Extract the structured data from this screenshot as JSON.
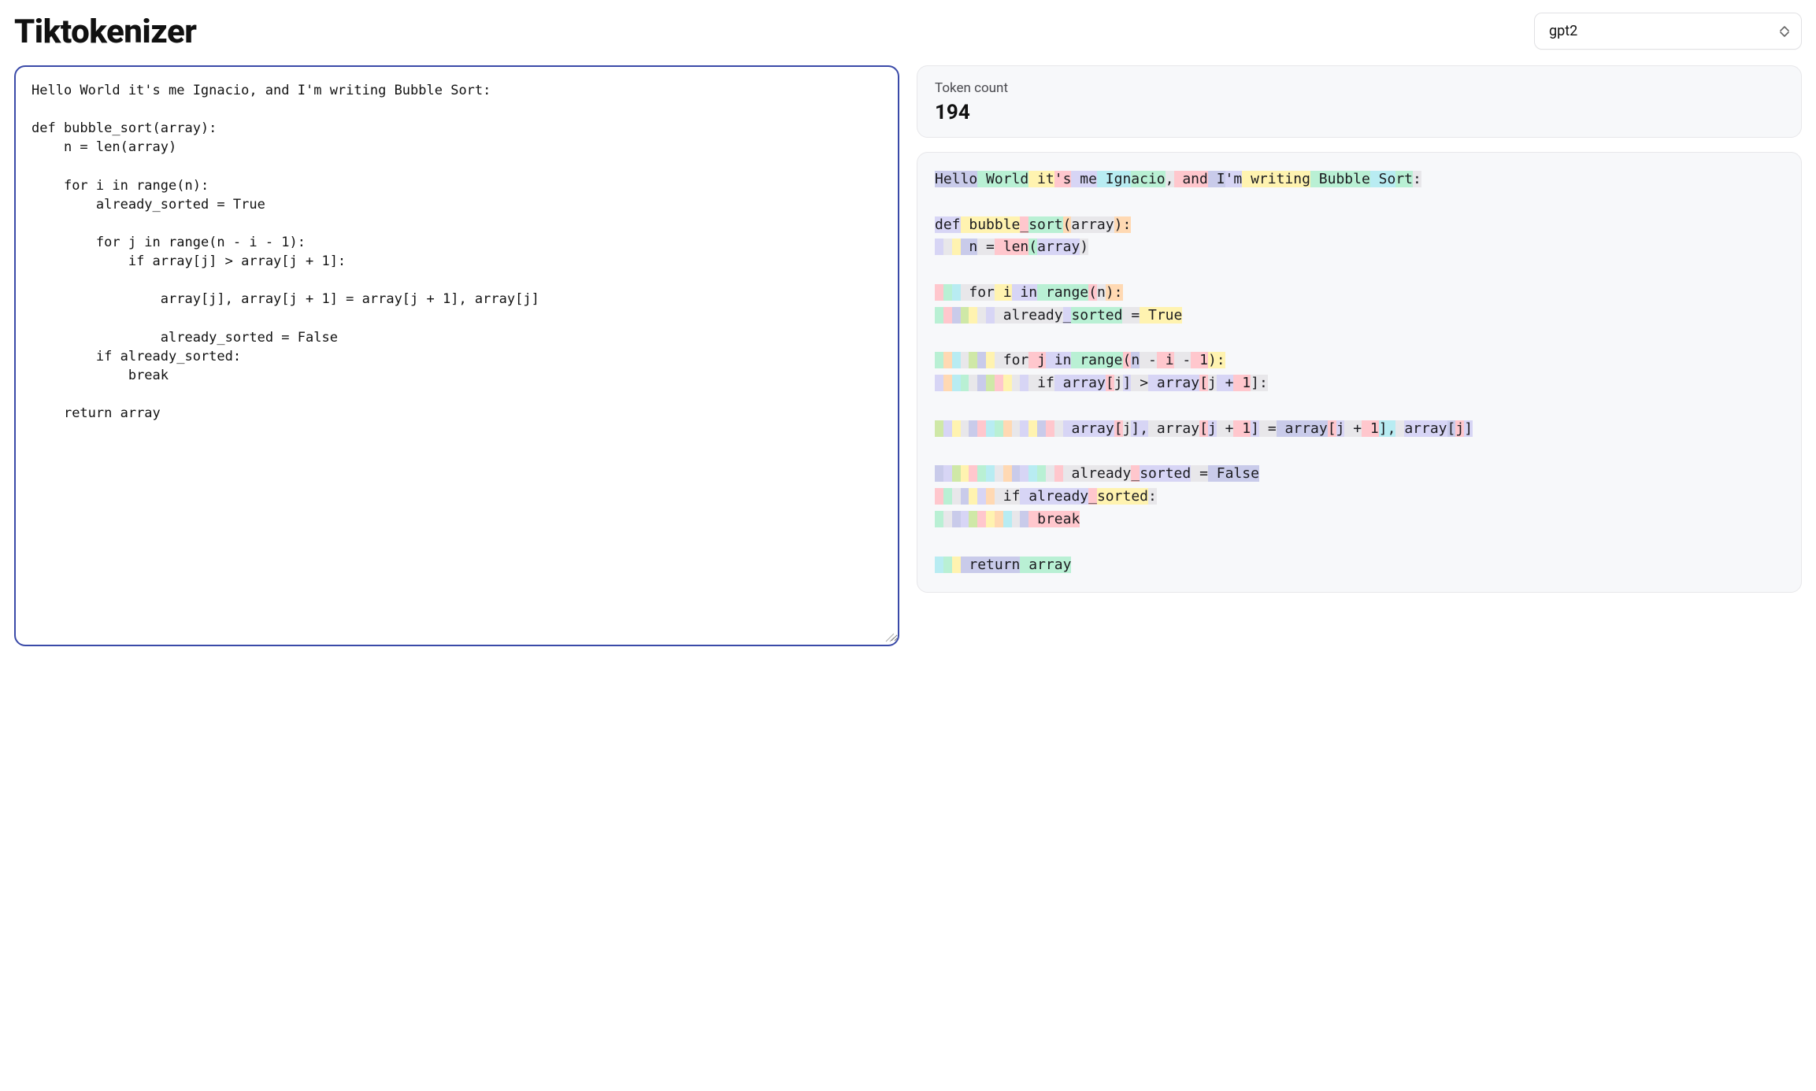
{
  "header": {
    "title": "Tiktokenizer",
    "model_select": {
      "value": "gpt2"
    }
  },
  "input": {
    "text": "Hello World it's me Ignacio, and I'm writing Bubble Sort:\n\ndef bubble_sort(array):\n    n = len(array)\n\n    for i in range(n):\n        already_sorted = True\n\n        for j in range(n - i - 1):\n            if array[j] > array[j + 1]:\n\n                array[j], array[j + 1] = array[j + 1], array[j]\n\n                already_sorted = False\n        if already_sorted:\n            break\n\n    return array"
  },
  "token_count": {
    "label": "Token count",
    "value": "194"
  },
  "palette": [
    "#c9cbea",
    "#b9f0d4",
    "#fff3b0",
    "#ffc7cd",
    "#d7d5f5",
    "#b8ecf2",
    "#f4d2ec",
    "#cfe8a7",
    "#e8e7ea",
    "#ffd9b3"
  ],
  "tokens": [
    {
      "t": "Hello",
      "c": 0
    },
    {
      "t": " World",
      "c": 1
    },
    {
      "t": " it",
      "c": 2
    },
    {
      "t": "'s",
      "c": 3
    },
    {
      "t": " me",
      "c": 4
    },
    {
      "t": " Ign",
      "c": 5
    },
    {
      "t": "acio",
      "c": 1
    },
    {
      "t": ",",
      "c": 8
    },
    {
      "t": " and",
      "c": 3
    },
    {
      "t": " I",
      "c": 0
    },
    {
      "t": "'m",
      "c": 4
    },
    {
      "t": " writing",
      "c": 2
    },
    {
      "t": " Bubble",
      "c": 1
    },
    {
      "t": " So",
      "c": 5
    },
    {
      "t": "rt",
      "c": 1
    },
    {
      "t": ":",
      "c": 8
    },
    {
      "t": "\n",
      "c": -1
    },
    {
      "t": "\n",
      "c": -1
    },
    {
      "t": "def",
      "c": 4
    },
    {
      "t": " bubble",
      "c": 2
    },
    {
      "t": "_",
      "c": 3
    },
    {
      "t": "sort",
      "c": 1
    },
    {
      "t": "(",
      "c": 9
    },
    {
      "t": "array",
      "c": 8
    },
    {
      "t": "):",
      "c": 9
    },
    {
      "t": "\n",
      "c": -1
    },
    {
      "t": " ",
      "c": 4
    },
    {
      "t": " ",
      "c": 8
    },
    {
      "t": " ",
      "c": 2
    },
    {
      "t": " n",
      "c": 0
    },
    {
      "t": " =",
      "c": 8
    },
    {
      "t": " len",
      "c": 3
    },
    {
      "t": "(",
      "c": 1
    },
    {
      "t": "array",
      "c": 4
    },
    {
      "t": ")",
      "c": 8
    },
    {
      "t": "\n",
      "c": -1
    },
    {
      "t": "\n",
      "c": -1
    },
    {
      "t": " ",
      "c": 3
    },
    {
      "t": " ",
      "c": 1
    },
    {
      "t": " ",
      "c": 5
    },
    {
      "t": " for",
      "c": 8
    },
    {
      "t": " i",
      "c": 2
    },
    {
      "t": " in",
      "c": 4
    },
    {
      "t": " range",
      "c": 1
    },
    {
      "t": "(",
      "c": 3
    },
    {
      "t": "n",
      "c": 8
    },
    {
      "t": "):",
      "c": 9
    },
    {
      "t": "\n",
      "c": -1
    },
    {
      "t": " ",
      "c": 1
    },
    {
      "t": " ",
      "c": 3
    },
    {
      "t": " ",
      "c": 0
    },
    {
      "t": " ",
      "c": 7
    },
    {
      "t": " ",
      "c": 2
    },
    {
      "t": " ",
      "c": 8
    },
    {
      "t": " ",
      "c": 4
    },
    {
      "t": " already",
      "c": 8
    },
    {
      "t": "_",
      "c": 4
    },
    {
      "t": "sorted",
      "c": 1
    },
    {
      "t": " =",
      "c": 8
    },
    {
      "t": " True",
      "c": 2
    },
    {
      "t": "\n",
      "c": -1
    },
    {
      "t": "\n",
      "c": -1
    },
    {
      "t": " ",
      "c": 1
    },
    {
      "t": " ",
      "c": 9
    },
    {
      "t": " ",
      "c": 5
    },
    {
      "t": " ",
      "c": 8
    },
    {
      "t": " ",
      "c": 7
    },
    {
      "t": " ",
      "c": 0
    },
    {
      "t": " ",
      "c": 2
    },
    {
      "t": " for",
      "c": 8
    },
    {
      "t": " j",
      "c": 3
    },
    {
      "t": " in",
      "c": 4
    },
    {
      "t": " range",
      "c": 1
    },
    {
      "t": "(",
      "c": 3
    },
    {
      "t": "n",
      "c": 0
    },
    {
      "t": " -",
      "c": 8
    },
    {
      "t": " i",
      "c": 3
    },
    {
      "t": " -",
      "c": 8
    },
    {
      "t": " 1",
      "c": 3
    },
    {
      "t": "):",
      "c": 2
    },
    {
      "t": "\n",
      "c": -1
    },
    {
      "t": " ",
      "c": 4
    },
    {
      "t": " ",
      "c": 9
    },
    {
      "t": " ",
      "c": 5
    },
    {
      "t": " ",
      "c": 1
    },
    {
      "t": " ",
      "c": 8
    },
    {
      "t": " ",
      "c": 0
    },
    {
      "t": " ",
      "c": 7
    },
    {
      "t": " ",
      "c": 3
    },
    {
      "t": " ",
      "c": 2
    },
    {
      "t": " ",
      "c": 8
    },
    {
      "t": " ",
      "c": 4
    },
    {
      "t": " if",
      "c": 8
    },
    {
      "t": " array",
      "c": 4
    },
    {
      "t": "[",
      "c": 3
    },
    {
      "t": "j",
      "c": 8
    },
    {
      "t": "]",
      "c": 4
    },
    {
      "t": " >",
      "c": 8
    },
    {
      "t": " array",
      "c": 4
    },
    {
      "t": "[",
      "c": 3
    },
    {
      "t": "j",
      "c": 8
    },
    {
      "t": " +",
      "c": 4
    },
    {
      "t": " 1",
      "c": 3
    },
    {
      "t": "]:",
      "c": 8
    },
    {
      "t": "\n",
      "c": -1
    },
    {
      "t": "\n",
      "c": -1
    },
    {
      "t": " ",
      "c": 7
    },
    {
      "t": " ",
      "c": 4
    },
    {
      "t": " ",
      "c": 2
    },
    {
      "t": " ",
      "c": 8
    },
    {
      "t": " ",
      "c": 0
    },
    {
      "t": " ",
      "c": 3
    },
    {
      "t": " ",
      "c": 5
    },
    {
      "t": " ",
      "c": 1
    },
    {
      "t": " ",
      "c": 9
    },
    {
      "t": " ",
      "c": 8
    },
    {
      "t": " ",
      "c": 4
    },
    {
      "t": " ",
      "c": 2
    },
    {
      "t": " ",
      "c": 0
    },
    {
      "t": " ",
      "c": 3
    },
    {
      "t": " ",
      "c": 8
    },
    {
      "t": " array",
      "c": 4
    },
    {
      "t": "[",
      "c": 3
    },
    {
      "t": "j",
      "c": 8
    },
    {
      "t": "],",
      "c": 4
    },
    {
      "t": " array",
      "c": 8
    },
    {
      "t": "[",
      "c": 3
    },
    {
      "t": "j",
      "c": 4
    },
    {
      "t": " +",
      "c": 8
    },
    {
      "t": " 1",
      "c": 3
    },
    {
      "t": "]",
      "c": 4
    },
    {
      "t": " =",
      "c": 8
    },
    {
      "t": " array",
      "c": 0
    },
    {
      "t": "[",
      "c": 3
    },
    {
      "t": "j",
      "c": 4
    },
    {
      "t": " +",
      "c": 8
    },
    {
      "t": " 1",
      "c": 3
    },
    {
      "t": "],",
      "c": 5
    },
    {
      "t": " ",
      "c": 8
    },
    {
      "t": "array",
      "c": 4
    },
    {
      "t": "[",
      "c": 0
    },
    {
      "t": "j",
      "c": 3
    },
    {
      "t": "]",
      "c": 4
    },
    {
      "t": "\n",
      "c": -1
    },
    {
      "t": "\n",
      "c": -1
    },
    {
      "t": " ",
      "c": 0
    },
    {
      "t": " ",
      "c": 4
    },
    {
      "t": " ",
      "c": 7
    },
    {
      "t": " ",
      "c": 2
    },
    {
      "t": " ",
      "c": 3
    },
    {
      "t": " ",
      "c": 1
    },
    {
      "t": " ",
      "c": 5
    },
    {
      "t": " ",
      "c": 8
    },
    {
      "t": " ",
      "c": 9
    },
    {
      "t": " ",
      "c": 0
    },
    {
      "t": " ",
      "c": 4
    },
    {
      "t": " ",
      "c": 5
    },
    {
      "t": " ",
      "c": 1
    },
    {
      "t": " ",
      "c": 8
    },
    {
      "t": " ",
      "c": 3
    },
    {
      "t": " already",
      "c": 8
    },
    {
      "t": "_",
      "c": 3
    },
    {
      "t": "sorted",
      "c": 4
    },
    {
      "t": " =",
      "c": 8
    },
    {
      "t": " False",
      "c": 0
    },
    {
      "t": "\n",
      "c": -1
    },
    {
      "t": " ",
      "c": 3
    },
    {
      "t": " ",
      "c": 1
    },
    {
      "t": " ",
      "c": 8
    },
    {
      "t": " ",
      "c": 0
    },
    {
      "t": " ",
      "c": 2
    },
    {
      "t": " ",
      "c": 4
    },
    {
      "t": " ",
      "c": 9
    },
    {
      "t": " if",
      "c": 8
    },
    {
      "t": " already",
      "c": 4
    },
    {
      "t": "_",
      "c": 3
    },
    {
      "t": "sorted",
      "c": 2
    },
    {
      "t": ":",
      "c": 8
    },
    {
      "t": "\n",
      "c": -1
    },
    {
      "t": " ",
      "c": 1
    },
    {
      "t": " ",
      "c": 8
    },
    {
      "t": " ",
      "c": 0
    },
    {
      "t": " ",
      "c": 4
    },
    {
      "t": " ",
      "c": 7
    },
    {
      "t": " ",
      "c": 3
    },
    {
      "t": " ",
      "c": 2
    },
    {
      "t": " ",
      "c": 9
    },
    {
      "t": " ",
      "c": 5
    },
    {
      "t": " ",
      "c": 8
    },
    {
      "t": " ",
      "c": 0
    },
    {
      "t": " break",
      "c": 3
    },
    {
      "t": "\n",
      "c": -1
    },
    {
      "t": "\n",
      "c": -1
    },
    {
      "t": " ",
      "c": 5
    },
    {
      "t": " ",
      "c": 1
    },
    {
      "t": " ",
      "c": 2
    },
    {
      "t": " return",
      "c": 0
    },
    {
      "t": " array",
      "c": 1
    }
  ]
}
